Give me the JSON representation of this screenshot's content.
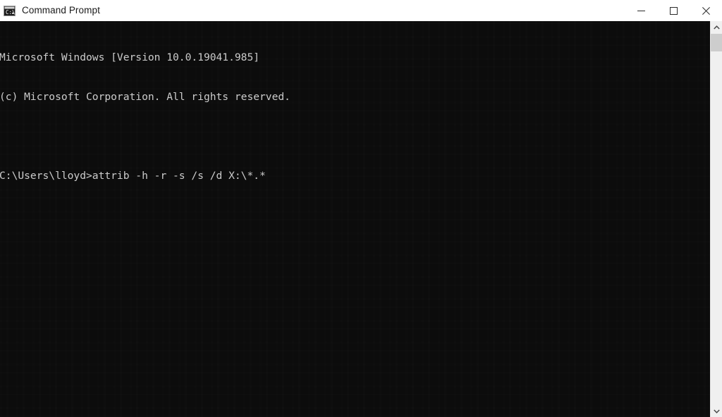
{
  "window": {
    "title": "Command Prompt",
    "app_icon": "command-prompt-icon",
    "background_color": "#0c0c0c",
    "titlebar_color": "#ffffff",
    "text_color": "#cccccc"
  },
  "window_controls": {
    "minimize": "minimize-icon",
    "maximize": "maximize-icon",
    "close": "close-icon"
  },
  "console": {
    "lines": [
      "Microsoft Windows [Version 10.0.19041.985]",
      "(c) Microsoft Corporation. All rights reserved.",
      "",
      "C:\\Users\\lloyd>attrib -h -r -s /s /d X:\\*.*"
    ],
    "prompt": "C:\\Users\\lloyd>",
    "command": "attrib -h -r -s /s /d X:\\*.*",
    "os_name": "Microsoft Windows",
    "os_version": "10.0.19041.985",
    "copyright": "(c) Microsoft Corporation. All rights reserved."
  },
  "scrollbar": {
    "up_arrow": "chevron-up-icon",
    "down_arrow": "chevron-down-icon",
    "thumb": "scrollbar-thumb"
  }
}
